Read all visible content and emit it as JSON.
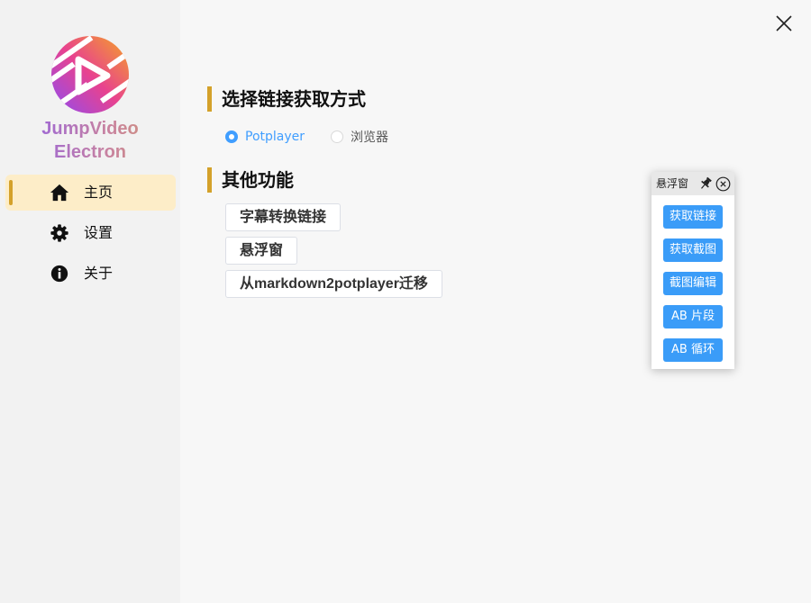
{
  "app": {
    "name_line1": "JumpVideo",
    "name_line2": "Electron",
    "logo_colors": [
      "#f0a020",
      "#e04090",
      "#9a4cf0"
    ]
  },
  "sidebar": {
    "items": [
      {
        "label": "主页",
        "icon": "home-icon",
        "active": true
      },
      {
        "label": "设置",
        "icon": "gear-icon",
        "active": false
      },
      {
        "label": "关于",
        "icon": "info-icon",
        "active": false
      }
    ],
    "active_bg": "#fdedc8",
    "active_accent": "#d4a12a"
  },
  "main": {
    "link_section": {
      "title": "选择链接获取方式",
      "options": [
        {
          "label": "Potplayer",
          "checked": true
        },
        {
          "label": "浏览器",
          "checked": false
        }
      ]
    },
    "other_section": {
      "title": "其他功能",
      "buttons": [
        {
          "label": "字幕转换链接"
        },
        {
          "label": "悬浮窗"
        },
        {
          "label": "从markdown2potplayer迁移"
        }
      ]
    }
  },
  "floating_window": {
    "title": "悬浮窗",
    "pin_icon": "pin-icon",
    "close_icon": "close-circle-icon",
    "buttons": [
      {
        "label": "获取链接"
      },
      {
        "label": "获取截图"
      },
      {
        "label": "截图编辑"
      },
      {
        "label": "AB 片段"
      },
      {
        "label": "AB 循环"
      }
    ],
    "button_color": "#3a9cf8"
  },
  "window": {
    "close_icon": "close-icon"
  }
}
